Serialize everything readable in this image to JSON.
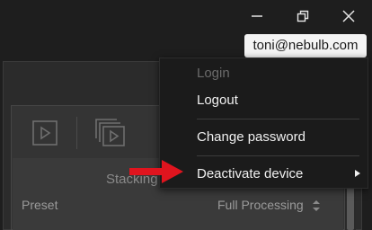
{
  "window": {
    "controls": {
      "minimize": "minimize-icon",
      "restore": "restore-icon",
      "close": "close-icon"
    }
  },
  "account": {
    "email": "toni@nebulb.com"
  },
  "menu": {
    "items": [
      {
        "label": "Login",
        "enabled": false
      },
      {
        "label": "Logout",
        "enabled": true
      },
      {
        "label": "Change password",
        "enabled": true
      },
      {
        "label": "Deactivate device",
        "enabled": true,
        "has_submenu": true
      }
    ]
  },
  "background_panel": {
    "section_title": "Stacking",
    "preset_label": "Preset",
    "preset_value": "Full Processing"
  },
  "colors": {
    "menu_bg": "#1b1b1b",
    "menu_text": "#f0f0f0",
    "menu_disabled": "#6a6a6a",
    "annotation_arrow": "#e0141e"
  }
}
